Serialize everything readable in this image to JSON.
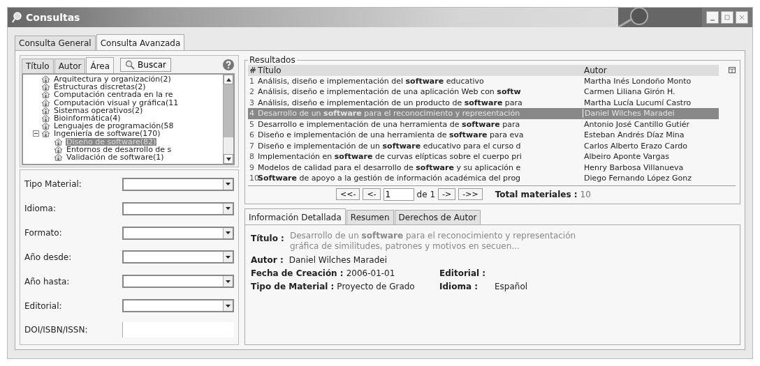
{
  "window": {
    "title": "Consultas"
  },
  "main_tabs": [
    {
      "label": "Consulta General",
      "selected": false
    },
    {
      "label": "Consulta Avanzada",
      "selected": true
    }
  ],
  "search_tabs": [
    {
      "label": "Título",
      "selected": false
    },
    {
      "label": "Autor",
      "selected": false
    },
    {
      "label": "Área",
      "selected": true
    }
  ],
  "search_button": {
    "label": "Buscar"
  },
  "tree": [
    {
      "label": "Arquitectura y organización(2)",
      "selected": false
    },
    {
      "label": "Estructuras discretas(2)",
      "selected": false
    },
    {
      "label": "Computación centrada en la re",
      "selected": false
    },
    {
      "label": "Computación visual y gráfica(11",
      "selected": false
    },
    {
      "label": "Sistemas operativos(2)",
      "selected": false
    },
    {
      "label": "Bioinformática(4)",
      "selected": false
    },
    {
      "label": "Lenguajes de programación(58",
      "selected": false
    },
    {
      "label": "Ingeniería de software(170)",
      "selected": false,
      "expanded": true,
      "children": [
        {
          "label": "Diseño de software(82)",
          "selected": true
        },
        {
          "label": "Entornos de desarrollo de s",
          "selected": false
        },
        {
          "label": "Validación de software(1)",
          "selected": false
        }
      ]
    }
  ],
  "filters": [
    {
      "label": "Tipo Material:",
      "kind": "dropdown"
    },
    {
      "label": "Idioma:",
      "kind": "dropdown"
    },
    {
      "label": "Formato:",
      "kind": "dropdown"
    },
    {
      "label": "Año desde:",
      "kind": "dropdown"
    },
    {
      "label": "Año hasta:",
      "kind": "dropdown"
    },
    {
      "label": "Editorial:",
      "kind": "dropdown"
    },
    {
      "label": "DOI/ISBN/ISSN:",
      "kind": "text"
    }
  ],
  "results": {
    "title": "Resultados",
    "columns": [
      "#",
      "Título",
      "Autor"
    ],
    "rows": [
      {
        "number": "1",
        "title": "Análisis, diseño e implementación del **software** educativo",
        "author": "Martha Inés Londoño Monto",
        "selected": false
      },
      {
        "number": "2",
        "title": "Análisis, diseño e implementación de una aplicación Web con **softw**",
        "author": "Carmen Liliana Girón H.",
        "selected": false
      },
      {
        "number": "3",
        "title": "Análisis, diseño e implementación de un producto de **software** para",
        "author": "Martha Lucía Lucumí Castro",
        "selected": false
      },
      {
        "number": "4",
        "title": "Desarrollo de un **software** para el reconocimiento y representación",
        "author": "Daniel Wilches Maradei",
        "selected": true
      },
      {
        "number": "5",
        "title": "Desarrollo e implementación de una herramienta de **software** para",
        "author": "Antonio José Cantillo Gutiér",
        "selected": false
      },
      {
        "number": "6",
        "title": "Diseño e implementación de una herramienta de **software** para eva",
        "author": "Esteban Andrés Díaz Mina",
        "selected": false
      },
      {
        "number": "7",
        "title": "Diseño e implementación de un **software** educativo para el curso d",
        "author": "Carlos Alberto Erazo Cardo",
        "selected": false
      },
      {
        "number": "8",
        "title": "Implementación en **software** de curvas elípticas sobre el cuerpo pri",
        "author": "Albeiro Aponte Vargas",
        "selected": false
      },
      {
        "number": "9",
        "title": "Modelos de calidad para el desarrollo de **software** y su aplicación e",
        "author": "Henry Barbosa Villanueva",
        "selected": false
      },
      {
        "number": "10",
        "title": "**Software** de apoyo a la gestión de información académica del prog",
        "author": "Diego Fernando López Gonz",
        "selected": false
      }
    ]
  },
  "pager": {
    "first": "<<-",
    "previous": "<-",
    "page": "1",
    "of": "de 1",
    "next": "->",
    "last": "->>",
    "total_label": "Total materiales :",
    "total": "10"
  },
  "detail_tabs": [
    {
      "label": "Información Detallada",
      "selected": true
    },
    {
      "label": "Resumen",
      "selected": false
    },
    {
      "label": "Derechos de Autor",
      "selected": false
    }
  ],
  "detail": {
    "title_label": "Título :",
    "title": "Desarrollo de un **software** para el reconocimiento y representación gráfica de similitudes, patrones y motivos en secuen...",
    "author_label": "Autor :",
    "author": "Daniel Wilches Maradei",
    "date_label": "Fecha de Creación :",
    "date": "2006-01-01",
    "publisher_label": "Editorial :",
    "type_label": "Tipo de Material :",
    "type": "Proyecto de Grado",
    "language_label": "Idioma :",
    "language": "Español"
  }
}
